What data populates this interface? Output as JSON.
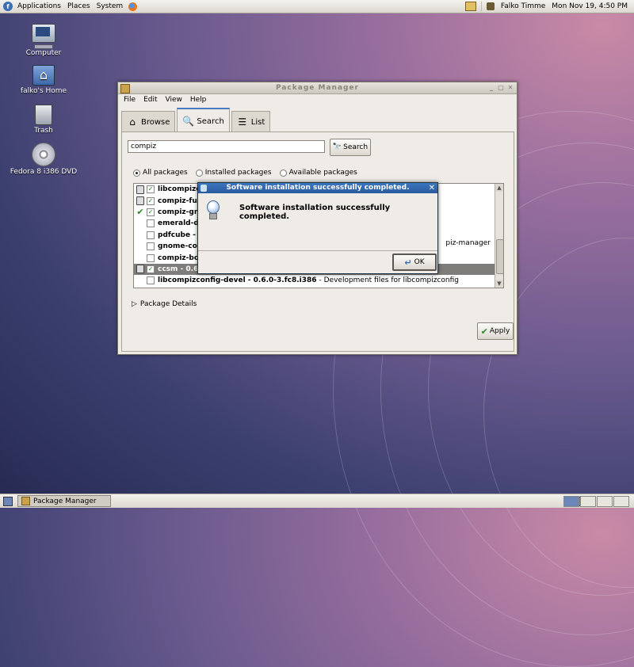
{
  "top_panel": {
    "menus": [
      "Applications",
      "Places",
      "System"
    ],
    "user": "Falko Timme",
    "clock": "Mon Nov 19,  4:50 PM"
  },
  "desktop": {
    "icons": [
      "Computer",
      "falko's Home",
      "Trash",
      "Fedora 8 i386 DVD"
    ]
  },
  "window": {
    "title": "Package Manager",
    "menu": [
      "File",
      "Edit",
      "View",
      "Help"
    ],
    "tabs": [
      "Browse",
      "Search",
      "List"
    ],
    "active_tab": "Search",
    "search_value": "compiz",
    "search_button": "Search",
    "filters": [
      "All packages",
      "Installed packages",
      "Available packages"
    ],
    "selected_filter": "All packages",
    "packages": [
      {
        "name": "libcompizco",
        "desc": "",
        "checked": true,
        "status": "lock"
      },
      {
        "name": "compiz-fusi",
        "desc": "",
        "checked": true,
        "status": "lock"
      },
      {
        "name": "compiz-gnom",
        "desc": "",
        "checked": true,
        "status": "ok"
      },
      {
        "name": "emerald-dev",
        "desc": "",
        "checked": false,
        "status": ""
      },
      {
        "name": "pdfcube - 0.",
        "desc": "",
        "checked": false,
        "status": ""
      },
      {
        "name": "gnome-comp",
        "desc": "",
        "checked": false,
        "status": ""
      },
      {
        "name": "compiz-bcop",
        "desc": "",
        "checked": false,
        "status": ""
      },
      {
        "name": "ccsm - 0.6.0",
        "desc": "",
        "checked": true,
        "status": "lock",
        "selected": true
      },
      {
        "name": "libcompizconfig-devel - 0.6.0-3.fc8.i386",
        "desc": "- Development files for libcompizconfig",
        "checked": false,
        "status": ""
      }
    ],
    "behind_dialog_text": "piz-manager",
    "package_details": "Package Details",
    "apply_button": "Apply"
  },
  "dialog": {
    "title": "Software installation successfully completed.",
    "message": "Software installation successfully completed.",
    "ok_button": "OK"
  },
  "taskbar": {
    "task": "Package Manager"
  }
}
